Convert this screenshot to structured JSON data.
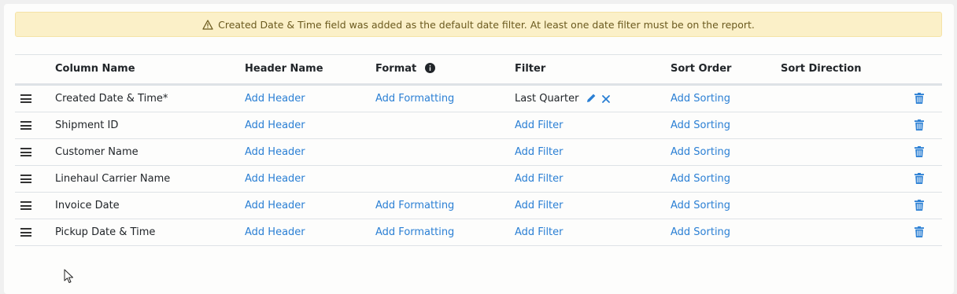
{
  "alert": {
    "icon": "warning-triangle-icon",
    "text": "Created Date & Time field was added as the default date filter. At least one date filter must be on the report."
  },
  "columns": {
    "column_name": "Column Name",
    "header_name": "Header Name",
    "format": "Format",
    "filter": "Filter",
    "sort_order": "Sort Order",
    "sort_direction": "Sort Direction"
  },
  "rows": [
    {
      "name": "Created Date & Time*",
      "header": "Add Header",
      "format": "Add Formatting",
      "filter": "Last Quarter",
      "sort": "Add Sorting"
    },
    {
      "name": "Shipment ID",
      "header": "Add Header",
      "format": "",
      "filter": "Add Filter",
      "sort": "Add Sorting"
    },
    {
      "name": "Customer Name",
      "header": "Add Header",
      "format": "",
      "filter": "Add Filter",
      "sort": "Add Sorting"
    },
    {
      "name": "Linehaul Carrier Name",
      "header": "Add Header",
      "format": "",
      "filter": "Add Filter",
      "sort": "Add Sorting"
    },
    {
      "name": "Invoice Date",
      "header": "Add Header",
      "format": "Add Formatting",
      "filter": "Add Filter",
      "sort": "Add Sorting"
    },
    {
      "name": "Pickup Date & Time",
      "header": "Add Header",
      "format": "Add Formatting",
      "filter": "Add Filter",
      "sort": "Add Sorting"
    }
  ],
  "colors": {
    "link": "#2a7fd4",
    "alert_bg": "#fbf0c8",
    "alert_text": "#6b5a1e"
  }
}
